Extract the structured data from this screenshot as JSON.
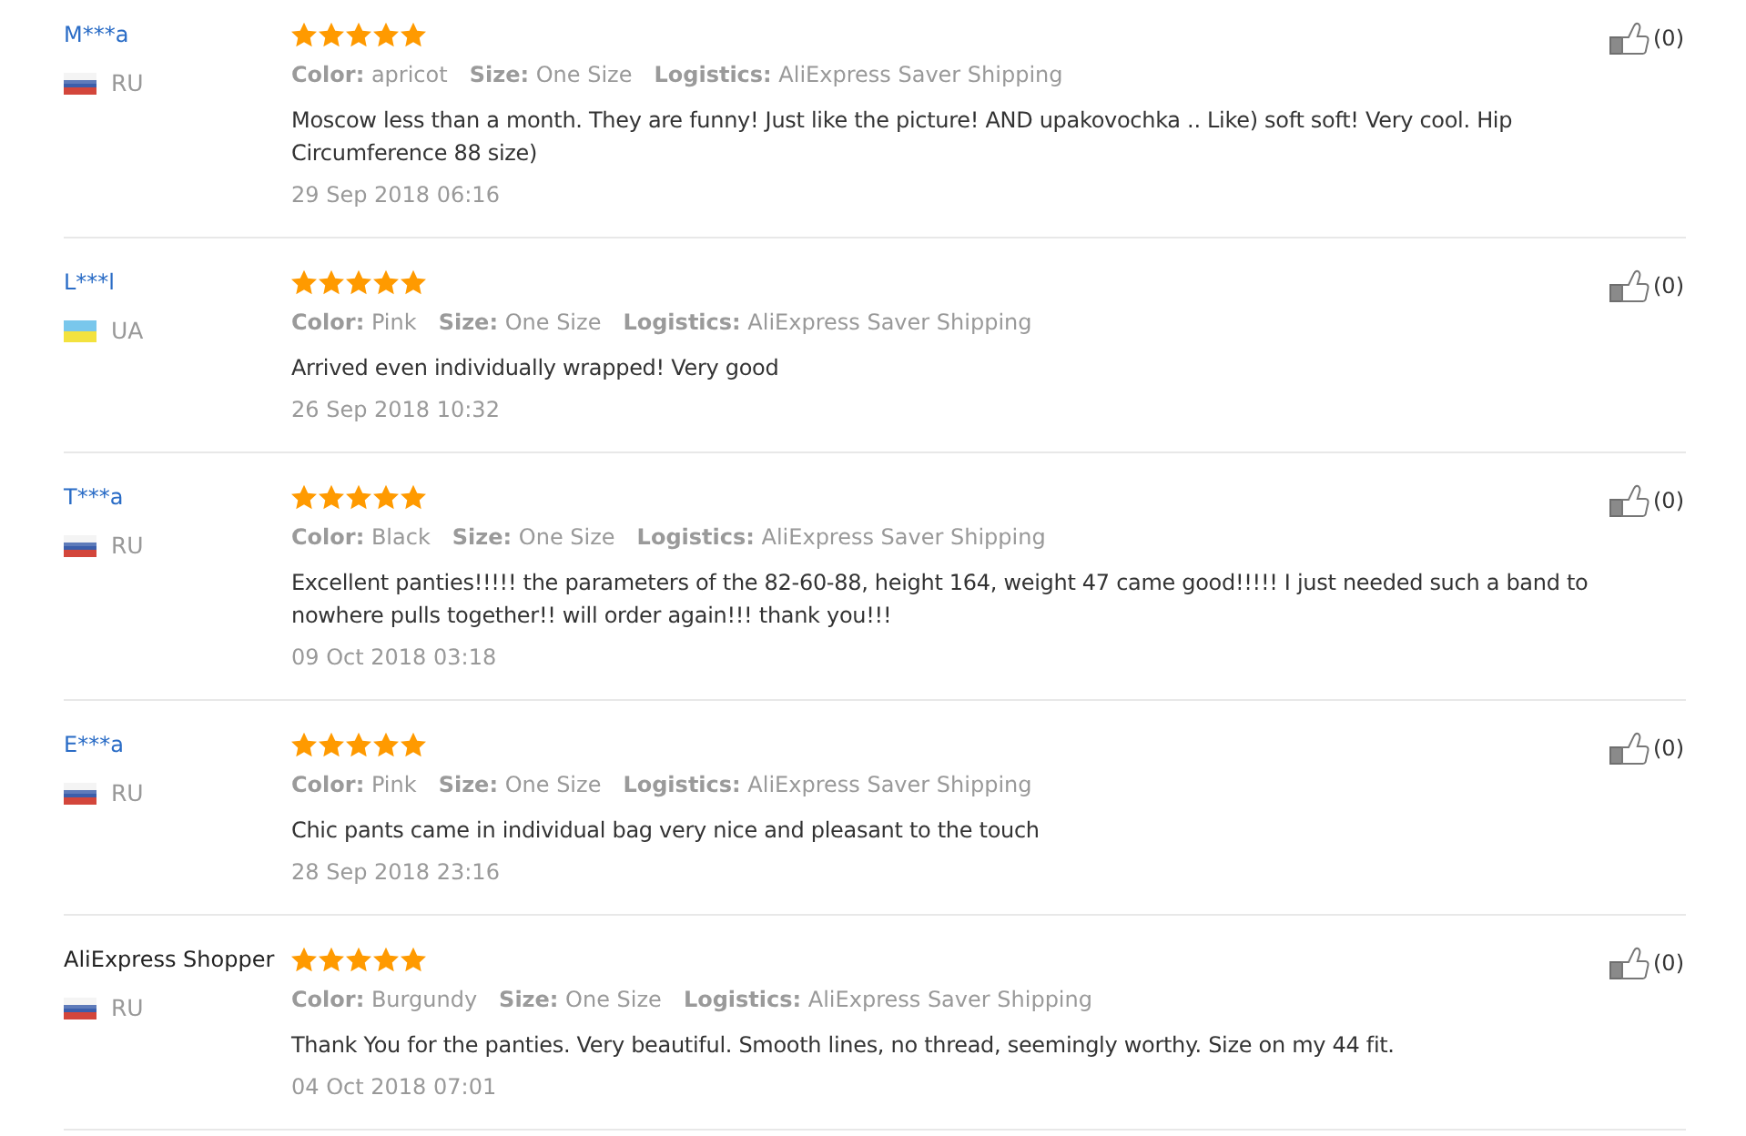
{
  "reviews": [
    {
      "name": "M***a",
      "link": true,
      "flag": {
        "kind": "ru"
      },
      "country": "RU",
      "stars": 5,
      "attributes": [
        {
          "label": "Color:",
          "value": "apricot"
        },
        {
          "label": "Size:",
          "value": "One Size"
        },
        {
          "label": "Logistics:",
          "value": "AliExpress Saver Shipping"
        }
      ],
      "text": "Moscow less than a month. They are funny! Just like the picture! AND upakovochka .. Like) soft soft! Very cool. Hip Circumference 88 size)",
      "date": "29 Sep 2018 06:16",
      "likes": "(0)"
    },
    {
      "name": "L***l",
      "link": true,
      "flag": {
        "kind": "ua"
      },
      "country": "UA",
      "stars": 5,
      "attributes": [
        {
          "label": "Color:",
          "value": "Pink"
        },
        {
          "label": "Size:",
          "value": "One Size"
        },
        {
          "label": "Logistics:",
          "value": "AliExpress Saver Shipping"
        }
      ],
      "text": "Arrived even individually wrapped! Very good",
      "date": "26 Sep 2018 10:32",
      "likes": "(0)"
    },
    {
      "name": "T***a",
      "link": true,
      "flag": {
        "kind": "ru"
      },
      "country": "RU",
      "stars": 5,
      "attributes": [
        {
          "label": "Color:",
          "value": "Black"
        },
        {
          "label": "Size:",
          "value": "One Size"
        },
        {
          "label": "Logistics:",
          "value": "AliExpress Saver Shipping"
        }
      ],
      "text": "Excellent panties!!!!! the parameters of the 82-60-88, height 164, weight 47 came good!!!!! I just needed such a band to nowhere pulls together!! will order again!!! thank you!!!",
      "date": "09 Oct 2018 03:18",
      "likes": "(0)"
    },
    {
      "name": "E***a",
      "link": true,
      "flag": {
        "kind": "ru"
      },
      "country": "RU",
      "stars": 5,
      "attributes": [
        {
          "label": "Color:",
          "value": "Pink"
        },
        {
          "label": "Size:",
          "value": "One Size"
        },
        {
          "label": "Logistics:",
          "value": "AliExpress Saver Shipping"
        }
      ],
      "text": "Chic pants came in individual bag very nice and pleasant to the touch",
      "date": "28 Sep 2018 23:16",
      "likes": "(0)"
    },
    {
      "name": "AliExpress Shopper",
      "link": false,
      "flag": {
        "kind": "ru"
      },
      "country": "RU",
      "stars": 5,
      "attributes": [
        {
          "label": "Color:",
          "value": "Burgundy"
        },
        {
          "label": "Size:",
          "value": "One Size"
        },
        {
          "label": "Logistics:",
          "value": "AliExpress Saver Shipping"
        }
      ],
      "text": "Thank You for the panties. Very beautiful. Smooth lines, no thread, seemingly worthy. Size on my 44 fit.",
      "date": "04 Oct 2018 07:01",
      "likes": "(0)"
    }
  ]
}
